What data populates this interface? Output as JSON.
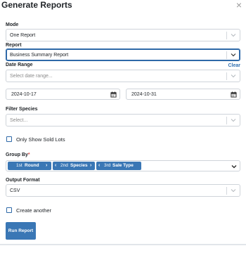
{
  "dialog": {
    "title": "Generate Reports",
    "close_symbol": "×"
  },
  "mode": {
    "label": "Mode",
    "value": "One Report"
  },
  "report": {
    "label": "Report",
    "value": "Business Summary Report"
  },
  "date_range": {
    "label": "Date Range",
    "clear_label": "Clear",
    "placeholder": "Select date range...",
    "start": "2024-10-17",
    "end": "2024-10-31"
  },
  "filter_species": {
    "label": "Filter Species",
    "placeholder": "Select..."
  },
  "only_sold": {
    "label": "Only Show Sold Lots",
    "checked": false
  },
  "group_by": {
    "label": "Group By",
    "required_mark": "*",
    "chips": [
      {
        "prefix": "1st",
        "name": "Round"
      },
      {
        "prefix": "2nd",
        "name": "Species"
      },
      {
        "prefix": "3rd",
        "name": "Sale Type"
      }
    ]
  },
  "output_format": {
    "label": "Output Format",
    "value": "CSV"
  },
  "create_another": {
    "label": "Create another",
    "checked": false
  },
  "run_button": {
    "label": "Run Report"
  },
  "colors": {
    "accent": "#3a77b5",
    "focus_border": "#2e69a8",
    "link": "#2f6fb0"
  },
  "icons": [
    "close-icon",
    "chevron-down-icon",
    "calendar-icon",
    "chevron-right-icon",
    "chevron-left-icon"
  ]
}
